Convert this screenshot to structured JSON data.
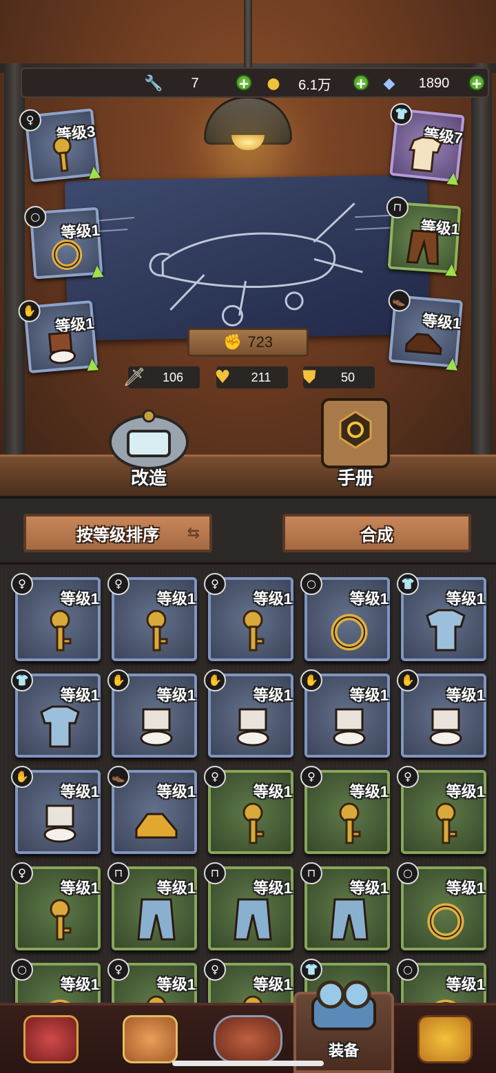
{
  "currency": {
    "wrench": {
      "icon": "wrench-icon",
      "value": "7"
    },
    "coin": {
      "icon": "coin-icon",
      "value": "6.1万"
    },
    "gem": {
      "icon": "diamond-icon",
      "value": "1890"
    }
  },
  "equipped": [
    {
      "slot": "key",
      "badge": "key-icon",
      "level": "等级3",
      "rarity": "blue"
    },
    {
      "slot": "ring",
      "badge": "ring-icon",
      "level": "等级1",
      "rarity": "blue"
    },
    {
      "slot": "glove",
      "badge": "glove-icon",
      "level": "等级1",
      "rarity": "blue"
    },
    {
      "slot": "shirt",
      "badge": "shirt-icon",
      "level": "等级7",
      "rarity": "purple"
    },
    {
      "slot": "pants",
      "badge": "pants-icon",
      "level": "等级1",
      "rarity": "green"
    },
    {
      "slot": "shoe",
      "badge": "shoe-icon",
      "level": "等级1",
      "rarity": "blue"
    }
  ],
  "power": "723",
  "stats": {
    "attack": "106",
    "health": "211",
    "defense": "50"
  },
  "actions": {
    "modify": "改造",
    "manual": "手册"
  },
  "sort_label": "按等级排序",
  "merge_label": "合成",
  "inventory": [
    {
      "type": "key",
      "level": "等级1",
      "rarity": "blue"
    },
    {
      "type": "key",
      "level": "等级1",
      "rarity": "blue"
    },
    {
      "type": "key",
      "level": "等级1",
      "rarity": "blue"
    },
    {
      "type": "ring",
      "level": "等级1",
      "rarity": "blue"
    },
    {
      "type": "shirt",
      "level": "等级1",
      "rarity": "blue"
    },
    {
      "type": "shirt",
      "level": "等级1",
      "rarity": "blue"
    },
    {
      "type": "glove",
      "level": "等级1",
      "rarity": "blue"
    },
    {
      "type": "glove",
      "level": "等级1",
      "rarity": "blue"
    },
    {
      "type": "glove",
      "level": "等级1",
      "rarity": "blue"
    },
    {
      "type": "glove",
      "level": "等级1",
      "rarity": "blue"
    },
    {
      "type": "glove",
      "level": "等级1",
      "rarity": "blue"
    },
    {
      "type": "shoe",
      "level": "等级1",
      "rarity": "blue"
    },
    {
      "type": "key",
      "level": "等级1",
      "rarity": "green"
    },
    {
      "type": "key",
      "level": "等级1",
      "rarity": "green"
    },
    {
      "type": "key",
      "level": "等级1",
      "rarity": "green"
    },
    {
      "type": "key",
      "level": "等级1",
      "rarity": "green"
    },
    {
      "type": "pants",
      "level": "等级1",
      "rarity": "green"
    },
    {
      "type": "pants",
      "level": "等级1",
      "rarity": "green"
    },
    {
      "type": "pants",
      "level": "等级1",
      "rarity": "green"
    },
    {
      "type": "ring",
      "level": "等级1",
      "rarity": "green"
    },
    {
      "type": "ring",
      "level": "等级1",
      "rarity": "green"
    },
    {
      "type": "key",
      "level": "等级1",
      "rarity": "green"
    },
    {
      "type": "key",
      "level": "等级1",
      "rarity": "green"
    },
    {
      "type": "shirt",
      "level": "",
      "rarity": "green"
    },
    {
      "type": "ring",
      "level": "等级1",
      "rarity": "green"
    }
  ],
  "nav": {
    "active_label": "装备"
  },
  "colors": {
    "accent_green": "#7fd34c",
    "blue_frame": "#8095bf",
    "green_frame": "#86a65a",
    "purple_frame": "#b59ad8"
  }
}
